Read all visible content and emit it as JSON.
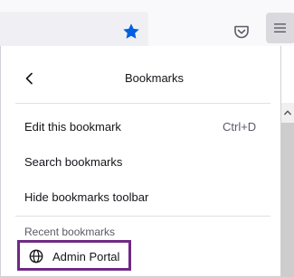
{
  "panel": {
    "title": "Bookmarks",
    "items": [
      {
        "label": "Edit this bookmark",
        "shortcut": "Ctrl+D"
      },
      {
        "label": "Search bookmarks"
      },
      {
        "label": "Hide bookmarks toolbar"
      }
    ],
    "recent_section_label": "Recent bookmarks",
    "recent_bookmarks": [
      {
        "label": "Admin Portal",
        "icon": "globe-icon"
      }
    ]
  },
  "toolbar": {
    "icons": [
      "star-icon",
      "pocket-icon",
      "hamburger-menu-icon"
    ]
  },
  "colors": {
    "star": "#0060df",
    "highlight_border": "#6e2a85"
  }
}
